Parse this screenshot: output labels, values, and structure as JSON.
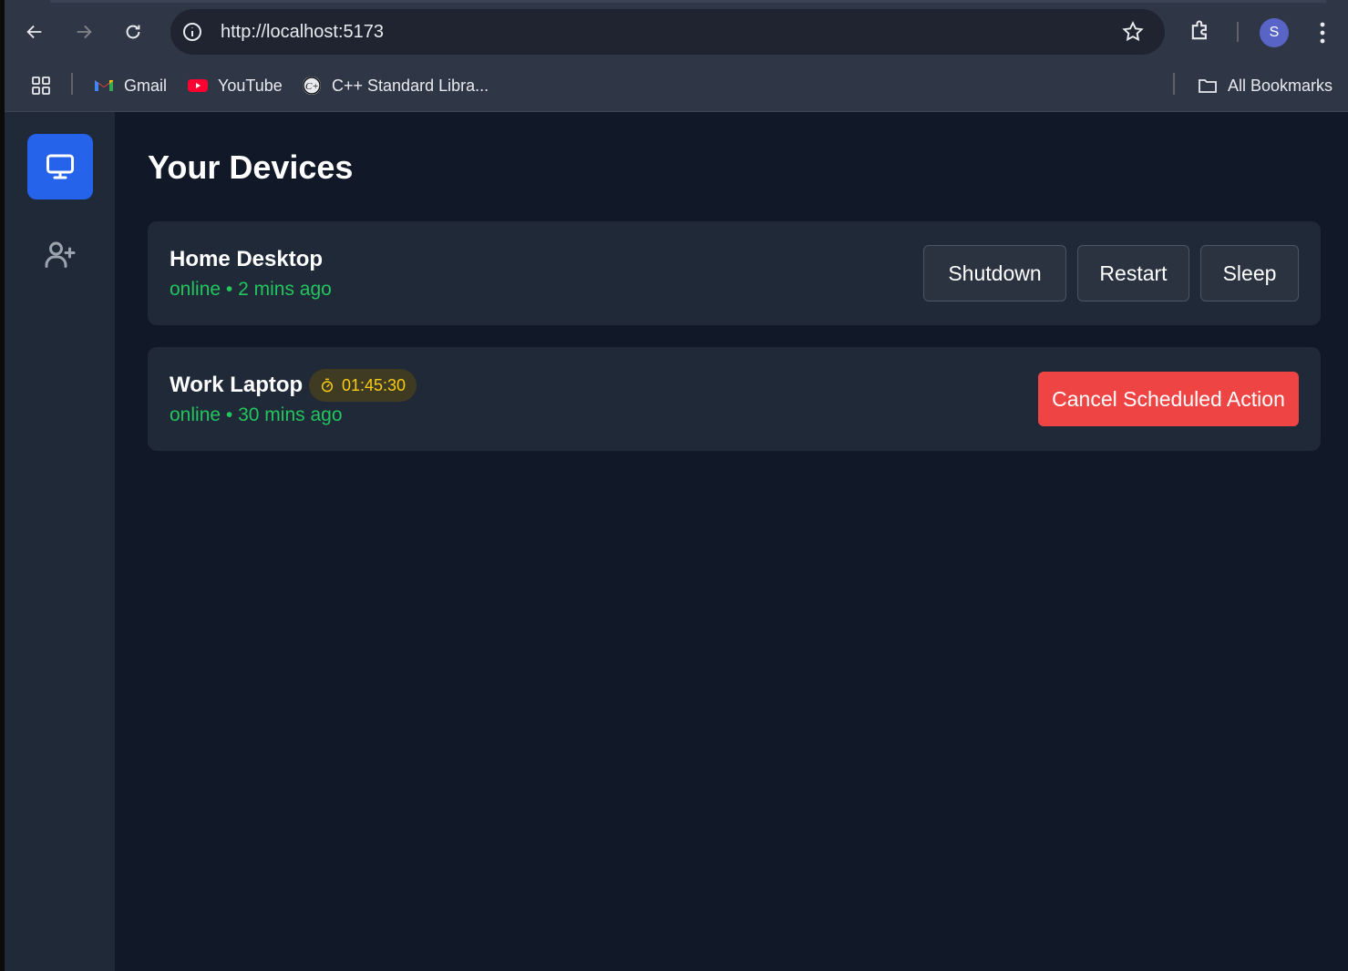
{
  "browser": {
    "url": "http://localhost:5173",
    "profile_initial": "S",
    "bookmarks": [
      {
        "label": "Gmail",
        "icon": "gmail-icon"
      },
      {
        "label": "YouTube",
        "icon": "youtube-icon"
      },
      {
        "label": "C++ Standard Libra...",
        "icon": "cpp-icon"
      }
    ],
    "all_bookmarks_label": "All Bookmarks"
  },
  "sidebar": {
    "items": [
      {
        "icon": "monitor-icon",
        "active": true
      },
      {
        "icon": "user-plus-icon",
        "active": false
      }
    ]
  },
  "main": {
    "title": "Your Devices",
    "devices": [
      {
        "name": "Home Desktop",
        "status": "online",
        "separator": "•",
        "last_seen": "2 mins ago",
        "actions": [
          "Shutdown",
          "Restart",
          "Sleep"
        ]
      },
      {
        "name": "Work Laptop",
        "timer": "01:45:30",
        "status": "online",
        "separator": "•",
        "last_seen": "30 mins ago",
        "cancel_label": "Cancel Scheduled Action"
      }
    ]
  },
  "colors": {
    "accent": "#2563eb",
    "online": "#22c55e",
    "danger": "#ef4444",
    "timer": "#facc15",
    "background": "#111827",
    "card": "#1f2937"
  }
}
